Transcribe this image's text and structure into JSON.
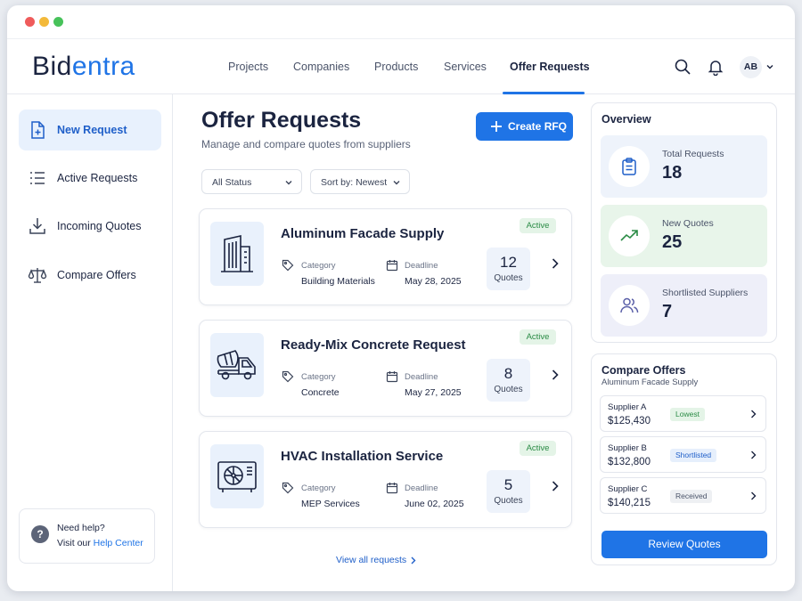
{
  "app": {
    "logo_part1": "Bid",
    "logo_part2": "entra"
  },
  "colors": {
    "accent": "#1f74e6",
    "active_badge": "#e4f4e7",
    "lowest_tag": "#e4f4e7",
    "shortlisted_tag": "#e6effc",
    "received_tag": "#eef0f3"
  },
  "nav": {
    "items": [
      {
        "label": "Projects"
      },
      {
        "label": "Companies"
      },
      {
        "label": "Products"
      },
      {
        "label": "Services"
      },
      {
        "label": "Offer Requests",
        "active": true
      }
    ],
    "icons": [
      "search-icon",
      "bell-icon"
    ],
    "avatar_initials": "AB"
  },
  "sidebar": {
    "items": [
      {
        "label": "New Request",
        "icon": "file-plus-icon",
        "active": true
      },
      {
        "label": "Active Requests",
        "icon": "list-icon"
      },
      {
        "label": "Incoming Quotes",
        "icon": "download-icon"
      },
      {
        "label": "Compare Offers",
        "icon": "scale-icon"
      }
    ],
    "help": {
      "title": "Need help?",
      "prefix": "Visit our",
      "link": "Help Center"
    }
  },
  "main": {
    "title": "Offer Requests",
    "subtitle": "Manage and compare quotes from suppliers",
    "create_button": "Create RFQ",
    "filters": {
      "status": "All Status",
      "sort": "Sort by: Newest"
    },
    "category_label": "Category",
    "deadline_label": "Deadline",
    "quotes_label": "Quotes",
    "requests": [
      {
        "title": "Aluminum Facade Supply",
        "status": "Active",
        "category": "Building Materials",
        "deadline": "May 28, 2025",
        "quotes": "12",
        "icon": "building-icon"
      },
      {
        "title": "Ready-Mix Concrete Request",
        "status": "Active",
        "category": "Concrete",
        "deadline": "May 27, 2025",
        "quotes": "8",
        "icon": "mixer-truck-icon"
      },
      {
        "title": "HVAC Installation Service",
        "status": "Active",
        "category": "MEP Services",
        "deadline": "June 02, 2025",
        "quotes": "5",
        "icon": "hvac-unit-icon"
      }
    ],
    "view_all": "View all requests"
  },
  "overview": {
    "title": "Overview",
    "stats": [
      {
        "label": "Total Requests",
        "value": "18",
        "icon": "clipboard-icon"
      },
      {
        "label": "New Quotes",
        "value": "25",
        "icon": "trend-up-icon"
      },
      {
        "label": "Shortlisted Suppliers",
        "value": "7",
        "icon": "users-icon"
      }
    ]
  },
  "compare": {
    "title": "Compare Offers",
    "subtitle": "Aluminum Facade Supply",
    "suppliers": [
      {
        "name": "Supplier A",
        "price": "$125,430",
        "tag": "Lowest"
      },
      {
        "name": "Supplier B",
        "price": "$132,800",
        "tag": "Shortlisted"
      },
      {
        "name": "Supplier C",
        "price": "$140,215",
        "tag": "Received"
      }
    ],
    "review_button": "Review Quotes"
  }
}
